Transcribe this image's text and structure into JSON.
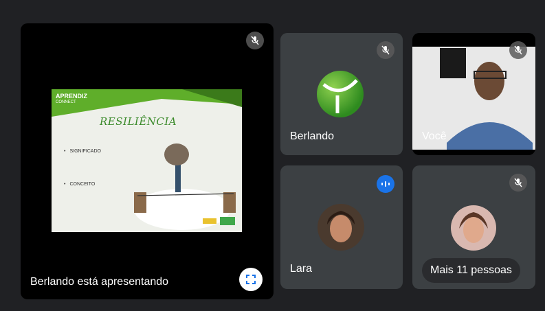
{
  "presenter": {
    "label": "Berlando está apresentando",
    "slide": {
      "brand_top": "APRENDIZ",
      "brand_sub": "CONNECT",
      "title": "RESILIÊNCIA",
      "bullets": [
        "SIGNIFICADO",
        "CONCEITO"
      ]
    }
  },
  "participants": [
    {
      "name": "Berlando",
      "muted": true
    },
    {
      "name": "Você",
      "muted": true
    },
    {
      "name": "Lara",
      "muted": false,
      "speaking": true
    }
  ],
  "more": {
    "label": "Mais 11 pessoas",
    "muted": true
  },
  "colors": {
    "background": "#202124",
    "tile": "#3c4043",
    "speaking": "#1a73e8"
  }
}
